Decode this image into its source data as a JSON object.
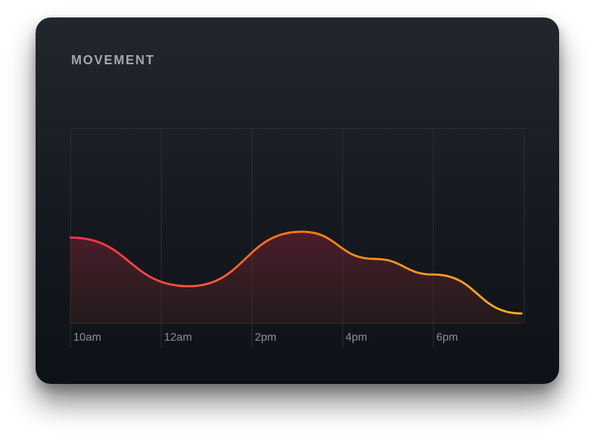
{
  "card": {
    "title": "MOVEMENT"
  },
  "chart_data": {
    "type": "area",
    "title": "MOVEMENT",
    "categories": [
      "10am",
      "12am",
      "2pm",
      "4pm",
      "6pm"
    ],
    "points": [
      {
        "x": 0,
        "y": 0.44
      },
      {
        "x": 1.3,
        "y": 0.19
      },
      {
        "x": 2.55,
        "y": 0.47
      },
      {
        "x": 3.35,
        "y": 0.33
      },
      {
        "x": 4.0,
        "y": 0.25
      },
      {
        "x": 4.97,
        "y": 0.05
      }
    ],
    "xlim": [
      0,
      5
    ],
    "ylim": [
      0,
      1
    ],
    "grid": "vertical",
    "legend": "none"
  },
  "colors": {
    "line_start": "#ff2d55",
    "line_mid": "#ff7a1a",
    "line_end": "#ffb020",
    "grid": "#2c3038",
    "tick_text": "#8c9097",
    "title_text": "#a4a7ad",
    "card_top": "#23262d",
    "card_bottom": "#0e1118"
  }
}
